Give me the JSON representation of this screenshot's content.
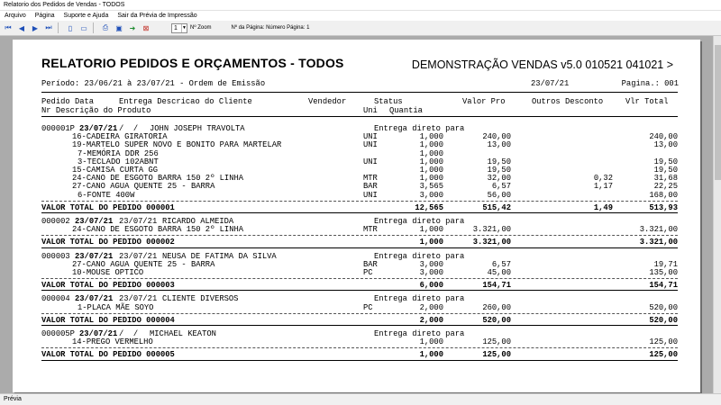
{
  "window": {
    "title": "Relatorio dos Pedidos de Vendas - TODOS"
  },
  "menu": [
    "Arquivo",
    "Página",
    "Suporte e Ajuda",
    "Sair da Prévia de Impressão"
  ],
  "toolbar": {
    "page_value": "1",
    "zoom_label": "Nº Zoom",
    "page_info": "Nº da Página: Número Página: 1"
  },
  "report": {
    "title": "RELATORIO PEDIDOS E ORÇAMENTOS - TODOS",
    "subtitle": "DEMONSTRAÇÃO VENDAS v5.0 010521 041021 >",
    "period": "Período: 23/06/21 à 23/07/21 - Ordem de Emissão",
    "date": "23/07/21",
    "page": "Pagina.: 001",
    "headers": {
      "pedido": "Pedido Data",
      "entrega": "Entrega Descricao do Cliente",
      "vendedor": "Vendedor",
      "status": "Status",
      "valor_pro": "Valor Pro",
      "outros": "Outros Desconto",
      "vlr_total": "Vlr Total",
      "nr_desc": "Nr Descrição do Produto",
      "uni": "Uni",
      "quantia": "Quantia"
    },
    "orders": [
      {
        "num": "000001P",
        "date": "23/07/21",
        "delivery": "/  /",
        "client": "JOHN JOSEPH TRAVOLTA",
        "status": "Entrega direto para",
        "items": [
          {
            "desc": "16-CADEIRA GIRATORIA",
            "uni": "UNI",
            "qty": "1,000",
            "price": "240,00",
            "disc": "",
            "total": "240,00"
          },
          {
            "desc": "19-MARTELO SUPER NOVO E BONITO PARA MARTELAR",
            "uni": "UNI",
            "qty": "1,000",
            "price": "13,00",
            "disc": "",
            "total": "13,00"
          },
          {
            "desc": "7-MEMÓRIA DDR 256",
            "uni": "",
            "qty": "1,000",
            "price": "",
            "disc": "",
            "total": ""
          },
          {
            "desc": "3-TECLADO 102ABNT",
            "uni": "UNI",
            "qty": "1,000",
            "price": "19,50",
            "disc": "",
            "total": "19,50"
          },
          {
            "desc": "15-CAMISA CURTA GG",
            "uni": "",
            "qty": "1,000",
            "price": "19,50",
            "disc": "",
            "total": "19,50"
          },
          {
            "desc": "24-CANO DE ESGOTO BARRA 150 2º LINHA",
            "uni": "MTR",
            "qty": "1,000",
            "price": "32,00",
            "disc": "0,32",
            "total": "31,68"
          },
          {
            "desc": "27-CANO AGUA QUENTE 25 - BARRA",
            "uni": "BAR",
            "qty": "3,565",
            "price": "6,57",
            "disc": "1,17",
            "total": "22,25"
          },
          {
            "desc": "6-FONTE 400W",
            "uni": "UNI",
            "qty": "3,000",
            "price": "56,00",
            "disc": "",
            "total": "168,00"
          }
        ],
        "total_label": "VALOR TOTAL DO PEDIDO 000001",
        "total_qty": "12,565",
        "total_price": "515,42",
        "total_disc": "1,49",
        "total_value": "513,93"
      },
      {
        "num": "000002",
        "date": "23/07/21",
        "delivery": "23/07/21",
        "client": "RICARDO ALMEIDA",
        "status": "Entrega direto para",
        "items": [
          {
            "desc": "24-CANO DE ESGOTO BARRA 150 2º LINHA",
            "uni": "MTR",
            "qty": "1,000",
            "price": "3.321,00",
            "disc": "",
            "total": "3.321,00"
          }
        ],
        "total_label": "VALOR TOTAL DO PEDIDO 000002",
        "total_qty": "1,000",
        "total_price": "3.321,00",
        "total_disc": "",
        "total_value": "3.321,00"
      },
      {
        "num": "000003",
        "date": "23/07/21",
        "delivery": "23/07/21",
        "client": "NEUSA DE FATIMA DA SILVA",
        "status": "Entrega direto para",
        "items": [
          {
            "desc": "27-CANO AGUA QUENTE 25 - BARRA",
            "uni": "BAR",
            "qty": "3,000",
            "price": "6,57",
            "disc": "",
            "total": "19,71"
          },
          {
            "desc": "10-MOUSE OPTICO",
            "uni": "PC",
            "qty": "3,000",
            "price": "45,00",
            "disc": "",
            "total": "135,00"
          }
        ],
        "total_label": "VALOR TOTAL DO PEDIDO 000003",
        "total_qty": "6,000",
        "total_price": "154,71",
        "total_disc": "",
        "total_value": "154,71"
      },
      {
        "num": "000004",
        "date": "23/07/21",
        "delivery": "23/07/21",
        "client": "CLIENTE DIVERSOS",
        "status": "Entrega direto para",
        "items": [
          {
            "desc": "1-PLACA MÃE SOYO",
            "uni": "PC",
            "qty": "2,000",
            "price": "260,00",
            "disc": "",
            "total": "520,00"
          }
        ],
        "total_label": "VALOR TOTAL DO PEDIDO 000004",
        "total_qty": "2,000",
        "total_price": "520,00",
        "total_disc": "",
        "total_value": "520,00"
      },
      {
        "num": "000005P",
        "date": "23/07/21",
        "delivery": "/  /",
        "client": "MICHAEL KEATON",
        "status": "Entrega direto para",
        "items": [
          {
            "desc": "14-PREGO VERMELHO",
            "uni": "",
            "qty": "1,000",
            "price": "125,00",
            "disc": "",
            "total": "125,00"
          }
        ],
        "total_label": "VALOR TOTAL DO PEDIDO 000005",
        "total_qty": "1,000",
        "total_price": "125,00",
        "total_disc": "",
        "total_value": "125,00"
      }
    ]
  },
  "status_bar": "Prévia"
}
